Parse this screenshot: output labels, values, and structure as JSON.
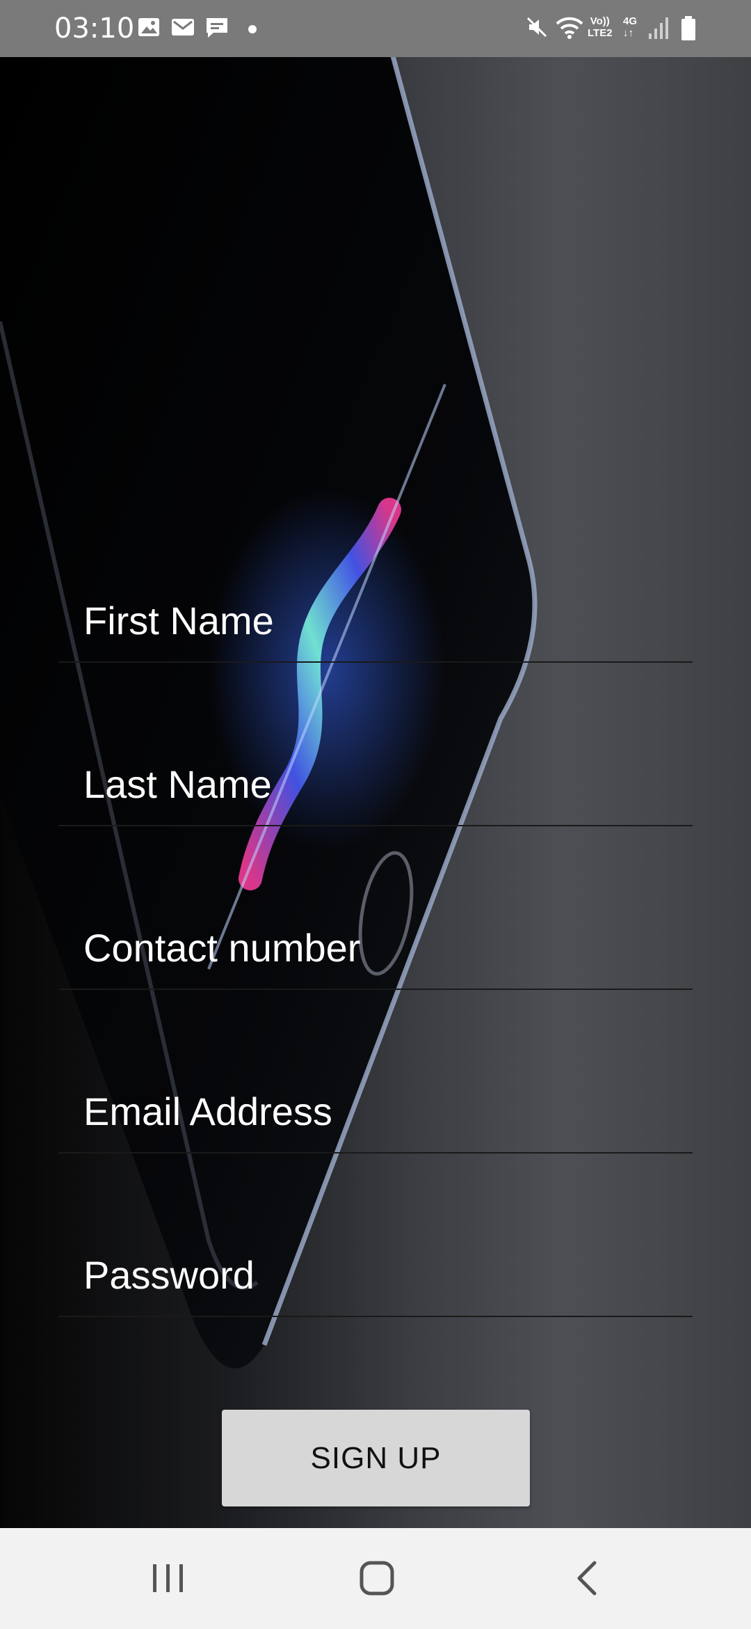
{
  "status_bar": {
    "time": "03:10",
    "network_volte": "Vo))",
    "network_lte": "LTE2",
    "network_gen": "4G",
    "icons": [
      "image-icon",
      "gmail-icon",
      "message-icon",
      "notification-dot-icon",
      "mute-icon",
      "wifi-icon",
      "signal-icon",
      "battery-icon"
    ]
  },
  "form": {
    "first_name_placeholder": "First Name",
    "last_name_placeholder": "Last Name",
    "contact_placeholder": "Contact number",
    "email_placeholder": "Email Address",
    "password_placeholder": "Password"
  },
  "actions": {
    "signup_label": "SIGN UP"
  },
  "nav": {
    "icons": [
      "recent-apps-icon",
      "home-icon",
      "back-icon"
    ]
  },
  "colors": {
    "status_bar": "#7a7a7a",
    "button": "#d7d7d7",
    "nav_bar": "#f2f2f2",
    "text": "#ffffff"
  }
}
